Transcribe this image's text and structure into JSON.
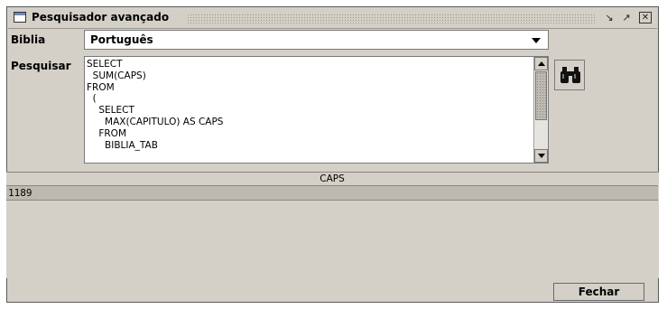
{
  "window": {
    "title": "Pesquisador avançado",
    "controls": [
      "iconify-icon",
      "maximize-icon",
      "close-icon"
    ]
  },
  "form": {
    "bible_label": "Biblia",
    "bible_selected": "Português",
    "search_label": "Pesquisar",
    "query_text": "SELECT\n  SUM(CAPS)\nFROM\n  (\n    SELECT\n      MAX(CAPITULO) AS CAPS\n    FROM\n      BIBLIA_TAB",
    "search_button_icon": "binoculars-icon"
  },
  "results": {
    "columns": [
      "CAPS"
    ],
    "rows": [
      [
        "1189"
      ]
    ]
  },
  "footer": {
    "close_label": "Fechar"
  }
}
